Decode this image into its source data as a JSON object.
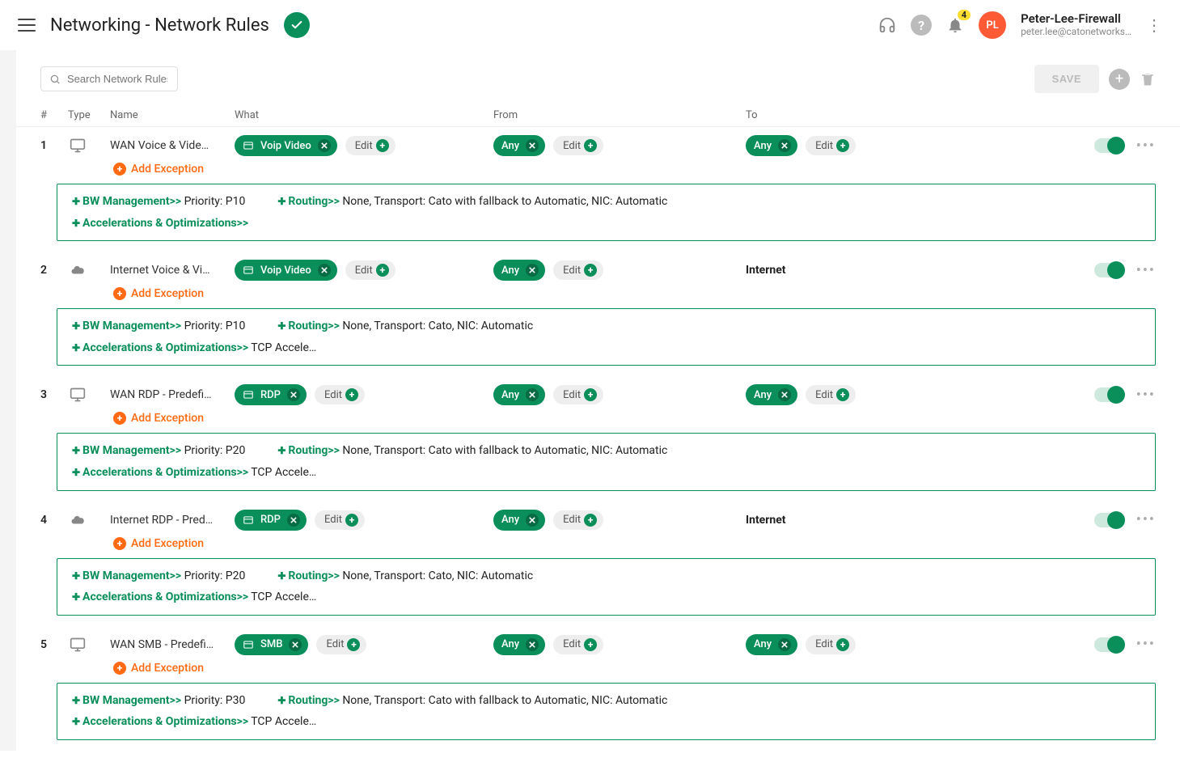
{
  "header": {
    "title": "Networking - Network Rules",
    "notification_count": "4",
    "avatar_initials": "PL",
    "user_name": "Peter-Lee-Firewall",
    "user_email": "peter.lee@catonetworks…"
  },
  "toolbar": {
    "search_placeholder": "Search Network Rules",
    "save_label": "SAVE"
  },
  "columns": {
    "idx": "#",
    "type": "Type",
    "name": "Name",
    "what": "What",
    "from": "From",
    "to": "To"
  },
  "common": {
    "edit_label": "Edit",
    "add_exception_label": "Add Exception",
    "bw_label": "BW Management>>",
    "routing_label": "Routing>>",
    "accel_label": "Accelerations & Optimizations>>"
  },
  "rules": [
    {
      "idx": "1",
      "name": "WAN Voice & Vide…",
      "type_icon": "wan",
      "what_chip": "Voip Video",
      "what_has_icon": true,
      "from_chip": "Any",
      "to_chip": "Any",
      "to_text": "",
      "bw_text": "Priority: P10",
      "routing_text": "None, Transport: Cato with fallback to Automatic, NIC: Automatic",
      "accel_text": ""
    },
    {
      "idx": "2",
      "name": "Internet Voice & Vi…",
      "type_icon": "internet",
      "what_chip": "Voip Video",
      "what_has_icon": true,
      "from_chip": "Any",
      "to_chip": "",
      "to_text": "Internet",
      "bw_text": "Priority: P10",
      "routing_text": "None, Transport: Cato, NIC: Automatic",
      "accel_text": "TCP Accele…"
    },
    {
      "idx": "3",
      "name": "WAN RDP - Predefi…",
      "type_icon": "wan",
      "what_chip": "RDP",
      "what_has_icon": true,
      "from_chip": "Any",
      "to_chip": "Any",
      "to_text": "",
      "bw_text": "Priority: P20",
      "routing_text": "None, Transport: Cato with fallback to Automatic, NIC: Automatic",
      "accel_text": "TCP Accele…"
    },
    {
      "idx": "4",
      "name": "Internet RDP - Pred…",
      "type_icon": "internet",
      "what_chip": "RDP",
      "what_has_icon": true,
      "from_chip": "Any",
      "to_chip": "",
      "to_text": "Internet",
      "bw_text": "Priority: P20",
      "routing_text": "None, Transport: Cato, NIC: Automatic",
      "accel_text": "TCP Accele…"
    },
    {
      "idx": "5",
      "name": "WAN SMB - Predefi…",
      "type_icon": "wan",
      "what_chip": "SMB",
      "what_has_icon": true,
      "from_chip": "Any",
      "to_chip": "Any",
      "to_text": "",
      "bw_text": "Priority: P30",
      "routing_text": "None, Transport: Cato with fallback to Automatic, NIC: Automatic",
      "accel_text": "TCP Accele…"
    }
  ]
}
